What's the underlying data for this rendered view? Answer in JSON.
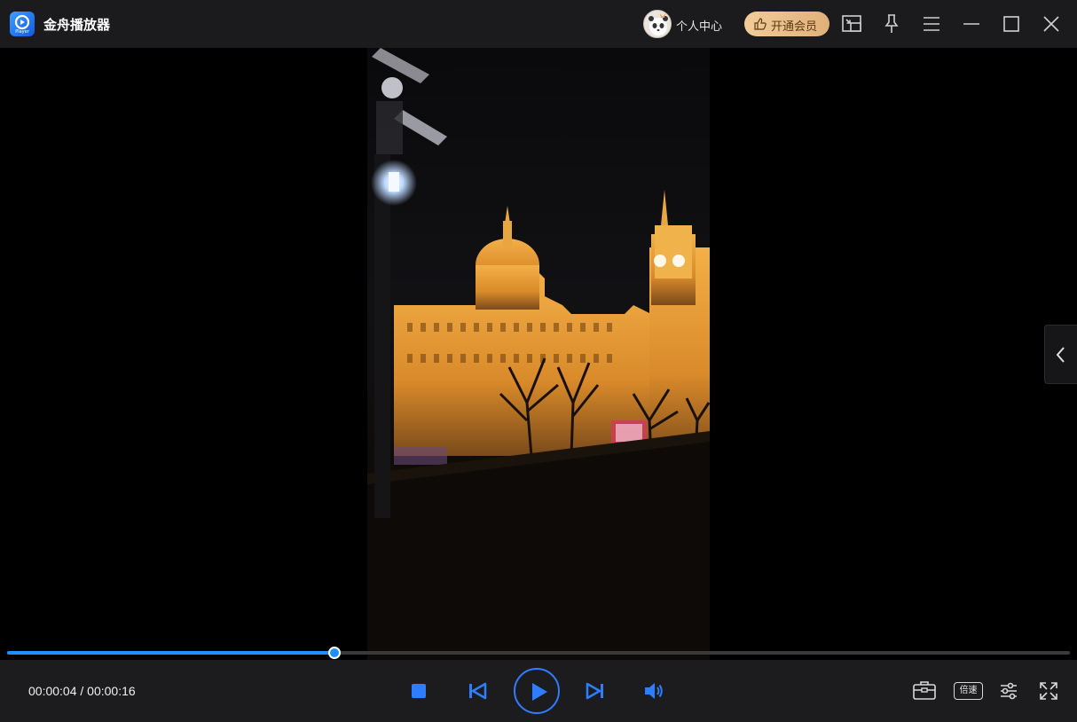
{
  "app": {
    "title": "金舟播放器",
    "logo_sub": "Player"
  },
  "header": {
    "user_center_label": "个人中心",
    "vip_label": "开通会员",
    "icons": [
      "screen-cast-icon",
      "pin-icon",
      "menu-icon",
      "minimize-icon",
      "maximize-icon",
      "close-icon"
    ]
  },
  "player": {
    "current_time": "00:00:04",
    "total_time": "00:00:16",
    "time_display": "00:00:04 / 00:00:16",
    "progress_fraction": 0.308,
    "speed_label": "倍速"
  },
  "colors": {
    "accent": "#1e8fff",
    "titlebar_bg": "#1b1b1d",
    "controlbar_bg": "#1c1c1e",
    "vip_gold": "#e9c08c"
  }
}
